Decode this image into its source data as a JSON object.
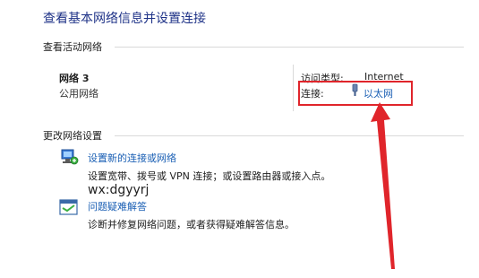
{
  "page_title": "查看基本网络信息并设置连接",
  "active_networks": {
    "section_title": "查看活动网络",
    "network_name": "网络 3",
    "network_type": "公用网络",
    "access_type_label": "访问类型:",
    "access_type_value": "Internet",
    "connections_label": "连接:",
    "connection_link": "以太网"
  },
  "change_settings": {
    "section_title": "更改网络设置",
    "items": [
      {
        "title": "设置新的连接或网络",
        "description": "设置宽带、拨号或 VPN 连接；或设置路由器或接入点。",
        "icon": "network-setup-icon"
      },
      {
        "title": "问题疑难解答",
        "description": "诊断并修复网络问题，或者获得疑难解答信息。",
        "icon": "troubleshoot-icon"
      }
    ]
  },
  "watermark": "wx:dgyyrj",
  "colors": {
    "title_blue": "#1e3287",
    "link_blue": "#1a5fb4",
    "annotation_red": "#e0252b"
  }
}
